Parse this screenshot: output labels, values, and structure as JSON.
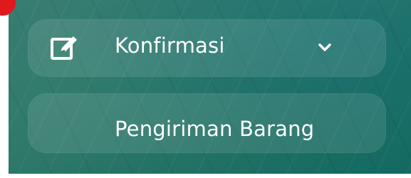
{
  "menu": {
    "items": [
      {
        "label": "Konfirmasi",
        "icon": "edit-icon",
        "expandable": true,
        "expand_icon": "chevron-down-icon"
      },
      {
        "label": "Pengiriman Barang"
      }
    ]
  },
  "colors": {
    "panel_background": "#2f7a6c",
    "item_background": "rgba(255,255,255,0.10)",
    "text": "#ffffff",
    "badge": "#e0191f"
  }
}
